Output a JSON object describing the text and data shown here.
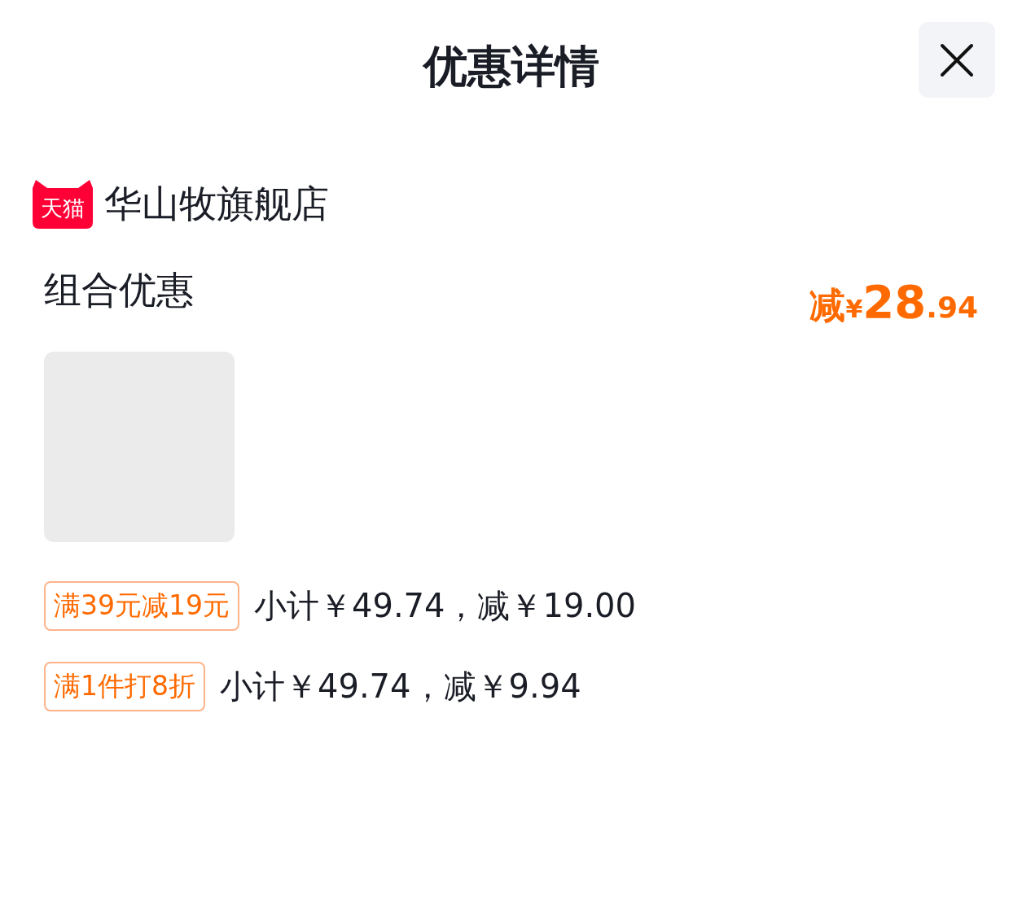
{
  "header": {
    "title": "优惠详情"
  },
  "store": {
    "badge": "天猫",
    "name": "华山牧旗舰店"
  },
  "promotion": {
    "title": "组合优惠",
    "discount": {
      "prefix": "减",
      "currency": "¥",
      "integer": "28",
      "decimal": ".94"
    },
    "product": {
      "kind": "placeholder"
    },
    "rules": [
      {
        "tag": "满39元减19元",
        "detail": "小计￥49.74，减￥19.00"
      },
      {
        "tag": "满1件打8折",
        "detail": "小计￥49.74，减￥9.94"
      }
    ]
  }
}
